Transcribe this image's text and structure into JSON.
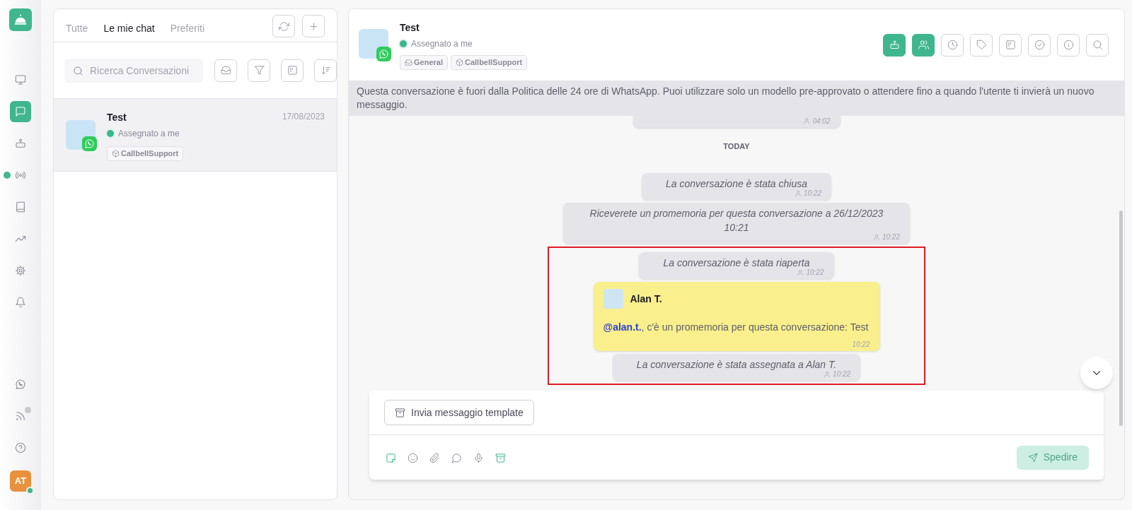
{
  "rail": {
    "logo": {
      "kind": "service-bell"
    },
    "items": [
      {
        "kind": "monitor",
        "selected": false
      },
      {
        "kind": "chat",
        "selected": true
      },
      {
        "kind": "robot",
        "selected": false
      },
      {
        "kind": "broadcast",
        "selected": false,
        "dot": true
      },
      {
        "kind": "book",
        "selected": false
      },
      {
        "kind": "trending",
        "selected": false
      },
      {
        "kind": "gear",
        "selected": false
      },
      {
        "kind": "bell",
        "selected": false
      }
    ],
    "bottom_items": [
      {
        "kind": "whatsapp",
        "selected": false
      },
      {
        "kind": "rss",
        "selected": false,
        "dot": true
      },
      {
        "kind": "help",
        "selected": false
      }
    ],
    "avatar": {
      "initials": "AT",
      "online": true
    }
  },
  "chat_list": {
    "tabs": [
      {
        "label": "Tutte",
        "selected": false
      },
      {
        "label": "Le mie chat",
        "selected": true
      },
      {
        "label": "Preferiti",
        "selected": false
      }
    ],
    "search": {
      "placeholder": "Ricerca Conversazioni"
    },
    "conversations": [
      {
        "name": "Test",
        "date": "17/08/2023",
        "status": "Assegnato a me",
        "tags": [
          "CallbellSupport"
        ],
        "selected": true
      }
    ]
  },
  "conversation": {
    "name": "Test",
    "status": "Assegnato a me",
    "tags": [
      {
        "kind": "inbox",
        "label": "General"
      },
      {
        "kind": "team",
        "label": "CallbellSupport"
      }
    ],
    "toolbar": [
      {
        "kind": "robot",
        "active": true
      },
      {
        "kind": "users",
        "active": true
      },
      {
        "kind": "clock",
        "active": false
      },
      {
        "kind": "tag",
        "active": false
      },
      {
        "kind": "kanban",
        "active": false
      },
      {
        "kind": "check",
        "active": false
      },
      {
        "kind": "info",
        "active": false
      },
      {
        "kind": "search",
        "active": false
      }
    ],
    "banner": "Questa conversazione è fuori dalla Politica delle 24 ore di WhatsApp. Puoi utilizzare solo un modello pre-approvato o attendere fino a quando l'utente ti invierà un nuovo messaggio.",
    "messages": [
      {
        "kind": "system",
        "time": "04:02",
        "highlighted": false
      },
      {
        "kind": "day",
        "text": "TODAY",
        "highlighted": false
      },
      {
        "kind": "system",
        "text": "La conversazione è stata chiusa",
        "time": "10:22",
        "highlighted": false
      },
      {
        "kind": "system",
        "text": "Riceverete un promemoria per questa conversazione a 26/12/2023 10:21",
        "time": "10:22",
        "highlighted": false
      },
      {
        "kind": "system",
        "text": "La conversazione è stata riaperta",
        "time": "10:22",
        "highlighted": true
      },
      {
        "kind": "note",
        "author": "Alan T.",
        "text": "**@alan.t.**, c'è un promemoria per questa conversazione: Test",
        "time": "10:22",
        "highlighted": true
      },
      {
        "kind": "system",
        "text": "La conversazione è stata assegnata a Alan T.",
        "time": "10:22",
        "highlighted": true
      }
    ],
    "composer": {
      "template_button": "Invia messaggio template",
      "tools": [
        {
          "kind": "note",
          "active": true
        },
        {
          "kind": "smile",
          "active": false
        },
        {
          "kind": "clip",
          "active": false
        },
        {
          "kind": "bubble",
          "active": false
        },
        {
          "kind": "mic",
          "active": false
        },
        {
          "kind": "archive",
          "active": true
        }
      ],
      "send": {
        "label": "Spedire",
        "disabled": true
      }
    }
  }
}
